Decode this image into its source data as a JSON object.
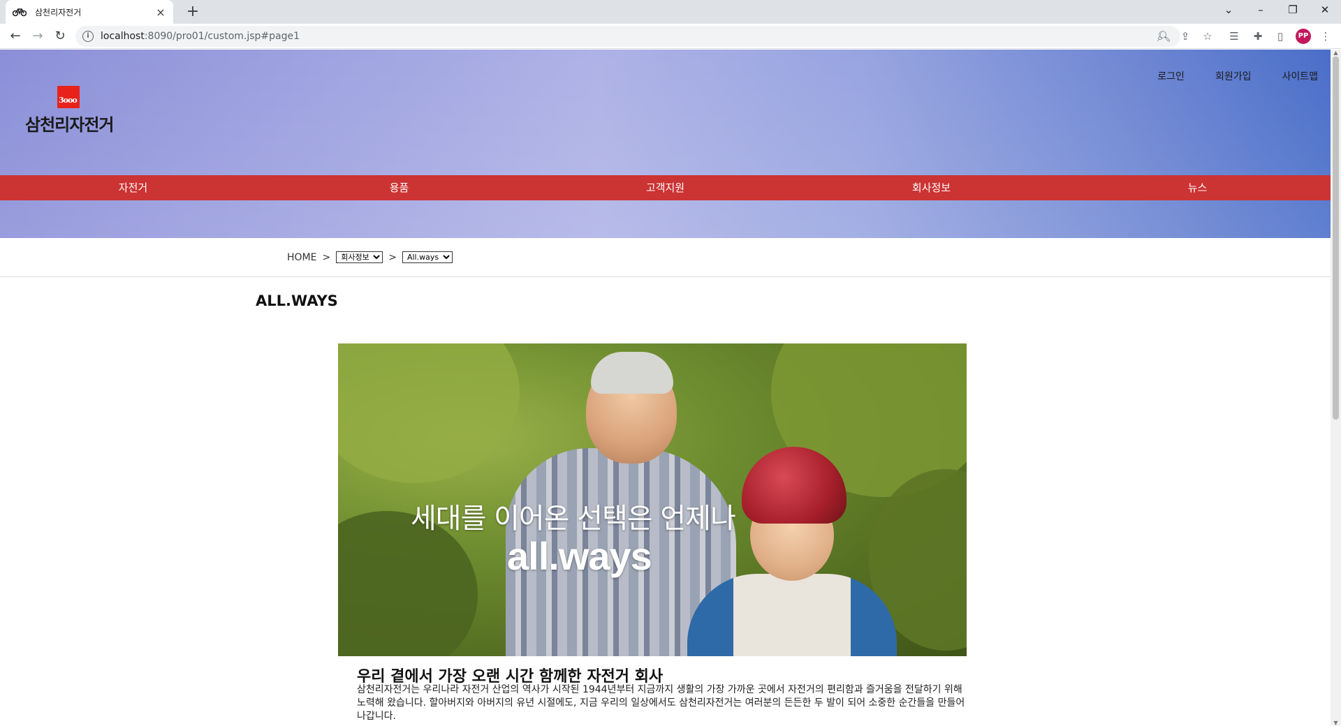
{
  "browser": {
    "tab_title": "삼천리자전거",
    "tab_close": "×",
    "new_tab": "+",
    "url_host": "localhost",
    "url_rest": ":8090/pro01/custom.jsp#page1",
    "profile_initials": "PP",
    "icons": [
      "back-icon",
      "forward-icon",
      "reload-icon",
      "info-icon",
      "zoom-icon",
      "share-icon",
      "star-icon",
      "reading-list-icon",
      "extensions-icon",
      "sidepanel-icon",
      "menu-icon"
    ]
  },
  "header": {
    "logo_mark_text": "3ooo",
    "logo_text": "삼천리자전거",
    "util_links": [
      "로그인",
      "회원가입",
      "사이트맵"
    ],
    "gnb": [
      "자전거",
      "용품",
      "고객지원",
      "회사정보",
      "뉴스"
    ]
  },
  "breadcrumb": {
    "home": "HOME",
    "sep": ">",
    "select1": "회사정보",
    "select2": "All.ways"
  },
  "main": {
    "title": "ALL.WAYS",
    "photo_slogan": "세대를 이어온 선택은 언제나",
    "photo_brand": "all.ways",
    "intro_heading": "우리 곁에서 가장 오랜 시간 함께한 자전거 회사",
    "intro_body": "삼천리자전거는 우리나라 자전거 산업의 역사가 시작된 1944년부터 지금까지 생활의 가장 가까운 곳에서 자전거의 편리함과 즐거움을 전달하기 위해 노력해 왔습니다. 할아버지와 아버지의 유년 시절에도, 지금 우리의 일상에서도 삼천리자전거는 여러분의 든든한 두 발이 되어 소중한 순간들을 만들어나갑니다."
  },
  "colors": {
    "gnb_bg": "#cc3333",
    "logo_red": "#e8221b",
    "hero_left": "#8b8fd8",
    "hero_right": "#4a6ec9"
  }
}
